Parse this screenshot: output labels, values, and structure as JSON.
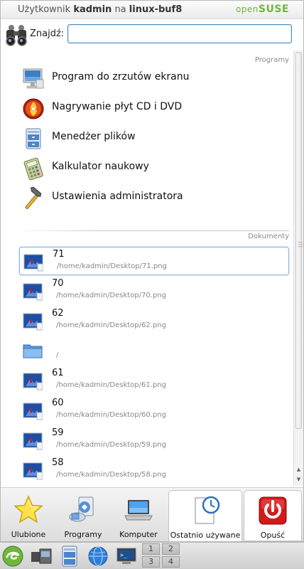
{
  "header": {
    "prefix": "Użytkownik",
    "username": "kadmin",
    "middle": "na",
    "hostname": "linux-buf8",
    "brand_open": "open",
    "brand_suse": "SUSE"
  },
  "search": {
    "label": "Znajdź:",
    "value": "",
    "placeholder": ""
  },
  "sections": {
    "programs_title": "Programy",
    "documents_title": "Dokumenty"
  },
  "programs": [
    {
      "label": "Program do zrzutów ekranu",
      "icon": "screenshot-icon"
    },
    {
      "label": "Nagrywanie płyt CD i DVD",
      "icon": "cd-burner-icon"
    },
    {
      "label": "Menedżer plików",
      "icon": "file-manager-icon"
    },
    {
      "label": "Kalkulator naukowy",
      "icon": "calculator-icon"
    },
    {
      "label": "Ustawienia administratora",
      "icon": "hammer-icon"
    }
  ],
  "documents": [
    {
      "name": "71",
      "path": "/home/kadmin/Desktop/71.png",
      "icon": "image-file-icon"
    },
    {
      "name": "70",
      "path": "/home/kadmin/Desktop/70.png",
      "icon": "image-file-icon"
    },
    {
      "name": "62",
      "path": "/home/kadmin/Desktop/62.png",
      "icon": "image-file-icon"
    },
    {
      "name": "",
      "path": "/",
      "icon": "folder-icon"
    },
    {
      "name": "61",
      "path": "/home/kadmin/Desktop/61.png",
      "icon": "image-file-icon"
    },
    {
      "name": "60",
      "path": "/home/kadmin/Desktop/60.png",
      "icon": "image-file-icon"
    },
    {
      "name": "59",
      "path": "/home/kadmin/Desktop/59.png",
      "icon": "image-file-icon"
    },
    {
      "name": "58",
      "path": "/home/kadmin/Desktop/58.png",
      "icon": "image-file-icon"
    }
  ],
  "tabs": [
    {
      "label": "Ulubione",
      "icon": "star-icon"
    },
    {
      "label": "Programy",
      "icon": "programs-icon"
    },
    {
      "label": "Komputer",
      "icon": "laptop-icon"
    },
    {
      "label": "Ostatnio używane",
      "icon": "recent-clock-icon",
      "active": true
    },
    {
      "label": "Opuść",
      "icon": "power-icon"
    }
  ],
  "taskbar": {
    "pager": [
      "1",
      "2",
      "3",
      "4"
    ],
    "icons": [
      "suse-menu-icon",
      "desktop-switch-icon",
      "file-manager-icon",
      "web-browser-icon",
      "terminal-icon"
    ]
  },
  "colors": {
    "brand_green": "#6fb63d",
    "selection_border": "#8fb4dc",
    "search_border": "#4a8ac4"
  }
}
